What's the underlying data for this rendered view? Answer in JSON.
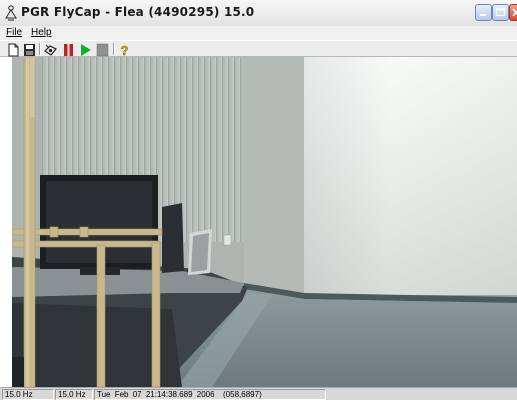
{
  "window": {
    "title": "PGR FlyCap - Flea (4490295) 15.0"
  },
  "menu": {
    "items": [
      {
        "label": "File"
      },
      {
        "label": "Help"
      }
    ]
  },
  "toolbar": {
    "buttons": [
      {
        "icon": "new-document-icon"
      },
      {
        "icon": "save-icon"
      },
      {
        "icon": "camera-settings-icon"
      },
      {
        "icon": "pause-icon"
      },
      {
        "icon": "play-icon"
      },
      {
        "icon": "stop-icon"
      },
      {
        "icon": "help-icon"
      }
    ]
  },
  "colors": {
    "pause": "#c81e1e",
    "play": "#15b02a",
    "stop": "#8f8f8f",
    "help": "#e0b400"
  },
  "statusbar": {
    "requested_rate": "15.0 Hz",
    "displayed_rate": "15.0 Hz",
    "timestamp": "Tue Feb 07 21:14:38.689 2006",
    "cursor": "(058,6897)"
  }
}
